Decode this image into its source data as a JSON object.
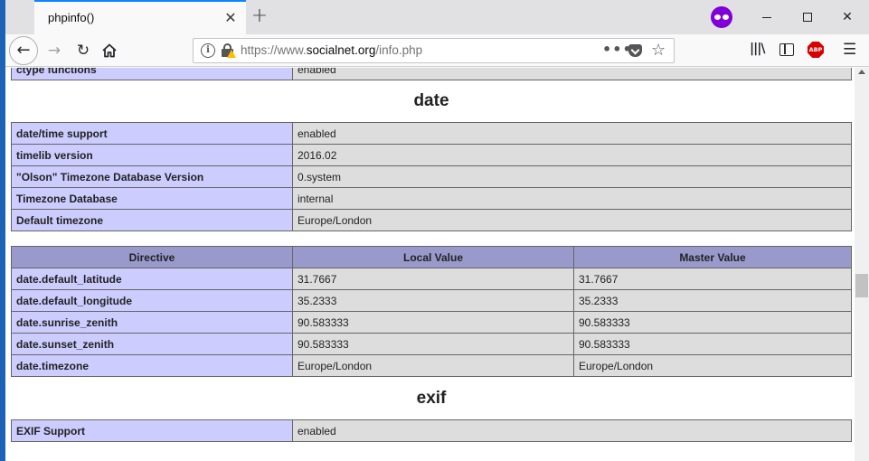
{
  "browser": {
    "tab_title": "phpinfo()",
    "tab_close": "✕",
    "new_tab": "+",
    "url_prefix": "https://www.",
    "url_host": "socialnet.org",
    "url_path": "/info.php",
    "page_actions": "•••",
    "abp_label": "ABP",
    "window_controls": {
      "close": "✕"
    }
  },
  "content": {
    "partial_row": {
      "label": "ctype functions",
      "value": "enabled"
    },
    "sections": [
      {
        "title": "date",
        "rows": [
          {
            "label": "date/time support",
            "value": "enabled"
          },
          {
            "label": "timelib version",
            "value": "2016.02"
          },
          {
            "label": "\"Olson\" Timezone Database Version",
            "value": "0.system"
          },
          {
            "label": "Timezone Database",
            "value": "internal"
          },
          {
            "label": "Default timezone",
            "value": "Europe/London"
          }
        ],
        "directives_header": [
          "Directive",
          "Local Value",
          "Master Value"
        ],
        "directives": [
          {
            "name": "date.default_latitude",
            "local": "31.7667",
            "master": "31.7667"
          },
          {
            "name": "date.default_longitude",
            "local": "35.2333",
            "master": "35.2333"
          },
          {
            "name": "date.sunrise_zenith",
            "local": "90.583333",
            "master": "90.583333"
          },
          {
            "name": "date.sunset_zenith",
            "local": "90.583333",
            "master": "90.583333"
          },
          {
            "name": "date.timezone",
            "local": "Europe/London",
            "master": "Europe/London"
          }
        ]
      },
      {
        "title": "exif",
        "rows": [
          {
            "label": "EXIF Support",
            "value": "enabled"
          }
        ]
      }
    ]
  }
}
